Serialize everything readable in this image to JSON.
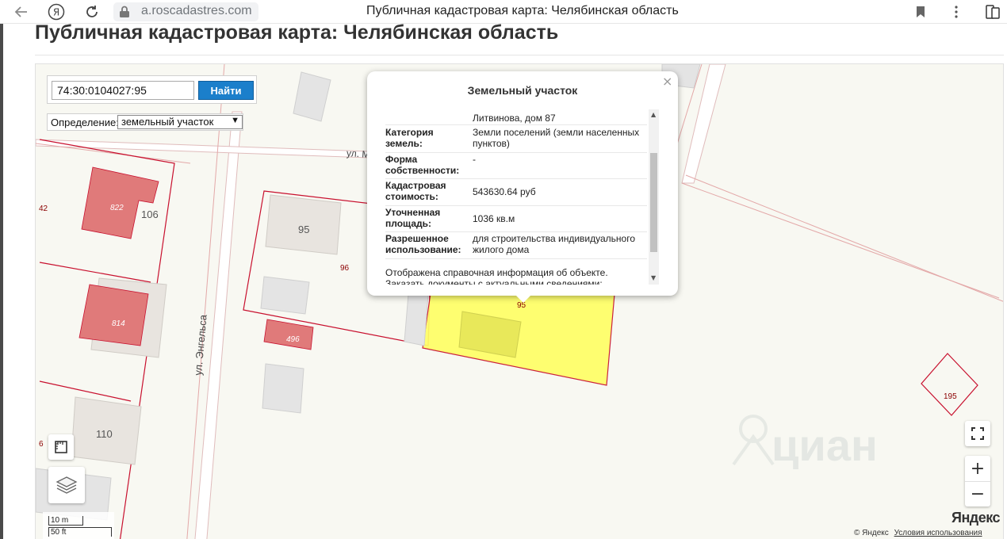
{
  "browser": {
    "url": "a.roscadastres.com",
    "tab_title": "Публичная кадастровая карта: Челябинская область"
  },
  "page": {
    "heading": "Публичная кадастровая карта: Челябинская область"
  },
  "search": {
    "value": "74:30:0104027:95",
    "button": "Найти"
  },
  "definition": {
    "label": "Определение:",
    "selected": "земельный участок"
  },
  "map_labels": {
    "street_engels": "ул. Энгельса",
    "street_m": "ул. М",
    "parcel_42": "42",
    "parcel_96": "96",
    "parcel_6": "6",
    "parcel_195": "195",
    "parcel_95_red": "95",
    "bld_822": "822",
    "bld_814": "814",
    "bld_496": "496",
    "house_106": "106",
    "house_95": "95",
    "house_110": "110"
  },
  "popup": {
    "title": "Земельный участок",
    "close": "×",
    "address_tail": "Литвинова, дом 87",
    "rows": [
      {
        "key": "Категория земель:",
        "value": "Земли поселений (земли населенных пунктов)"
      },
      {
        "key": "Форма собственности:",
        "value": "-"
      },
      {
        "key": "Кадастровая стоимость:",
        "value": "543630.64 руб"
      },
      {
        "key": "Уточненная площадь:",
        "value": "1036 кв.м"
      },
      {
        "key": "Разрешенное использование:",
        "value": "для строительства индивидуального жилого дома"
      }
    ],
    "note_line1": "Отображена справочная информация об объекте.",
    "note_line2": "Заказать документы с актуальными сведениями:"
  },
  "scale": {
    "metric": "10 m",
    "imperial": "50 ft"
  },
  "attribution": {
    "copyright": "© Яндекс",
    "terms": "Условия использования",
    "logo": "Яндекс"
  },
  "watermark": "циан",
  "controls": {
    "zoom_in": "+",
    "zoom_out": "−"
  },
  "colors": {
    "parcel_border": "#c8102e",
    "selected_parcel": "#ffff66",
    "accent_button": "#1b7fcb"
  }
}
